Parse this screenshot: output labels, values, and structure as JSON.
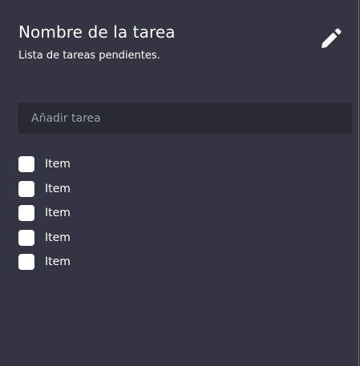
{
  "card": {
    "title": "Nombre de la tarea",
    "subtitle": "Lista de tareas pendientes.",
    "edit_icon": "pencil-icon"
  },
  "new_task": {
    "placeholder": "Añadir tarea",
    "value": ""
  },
  "tasks": [
    {
      "label": "Item",
      "checked": false
    },
    {
      "label": "Item",
      "checked": false
    },
    {
      "label": "Item",
      "checked": false
    },
    {
      "label": "Item",
      "checked": false
    },
    {
      "label": "Item",
      "checked": false
    }
  ],
  "colors": {
    "card_background": "#313642",
    "input_background": "#262a33",
    "text": "#ffffff",
    "placeholder": "#9aa0aa",
    "checkbox": "#ffffff"
  }
}
